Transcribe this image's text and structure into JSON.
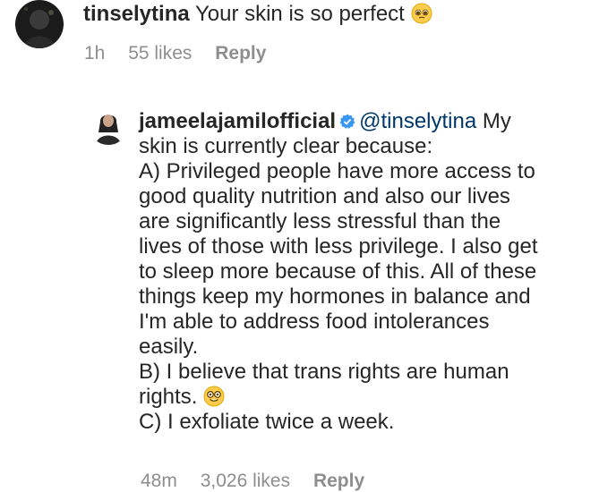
{
  "comment1": {
    "username": "tinselytina",
    "text": "Your skin is so perfect",
    "emoji": "pleading-face-emoji",
    "time": "1h",
    "likes": "55 likes",
    "reply": "Reply"
  },
  "comment2": {
    "username": "jameelajamilofficial",
    "verified": "verified-badge-icon",
    "mention": "@tinselytina",
    "lines": [
      "My",
      "skin is currently clear because:",
      "A) Privileged people have more access to",
      "good quality nutrition and also our lives",
      "are significantly less stressful than the",
      "lives of those with less privilege. I also get",
      "to sleep more because of this. All of these",
      "things keep my hormones in balance and",
      "I'm able to address food intolerances",
      "easily.",
      "B) I believe that trans rights are human",
      "rights.",
      "C) I exfoliate twice a week."
    ],
    "emoji": "nerd-face-emoji",
    "time": "48m",
    "likes": "3,026 likes",
    "reply": "Reply"
  },
  "colors": {
    "text": "#262626",
    "mention": "#00376b",
    "meta": "#8e8e8e",
    "verified": "#3897f0"
  }
}
